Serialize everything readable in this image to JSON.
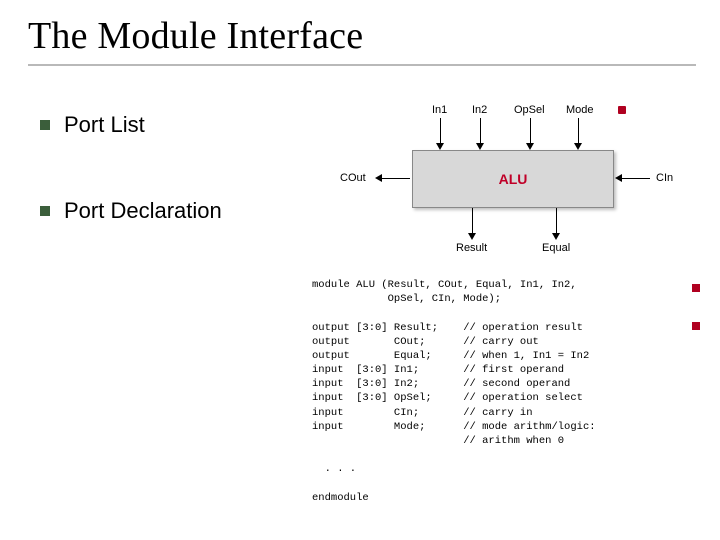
{
  "title": "The Module Interface",
  "bullets": [
    {
      "label": "Port List"
    },
    {
      "label": "Port Declaration"
    }
  ],
  "diagram": {
    "block_label": "ALU",
    "top_ports": [
      "In1",
      "In2",
      "OpSel",
      "Mode"
    ],
    "left_port": "COut",
    "right_port": "CIn",
    "bottom_ports": [
      "Result",
      "Equal"
    ]
  },
  "code": {
    "header1": "module ALU (Result, COut, Equal, In1, In2,",
    "header2": "            OpSel, CIn, Mode);",
    "blank": "",
    "l1": "output [3:0] Result;    // operation result",
    "l2": "output       COut;      // carry out",
    "l3": "output       Equal;     // when 1, In1 = In2",
    "l4": "input  [3:0] In1;       // first operand",
    "l5": "input  [3:0] In2;       // second operand",
    "l6": "input  [3:0] OpSel;     // operation select",
    "l7": "input        CIn;       // carry in",
    "l8": "input        Mode;      // mode arithm/logic:",
    "l9": "                        // arithm when 0",
    "dots": "  . . .",
    "end": "endmodule"
  }
}
